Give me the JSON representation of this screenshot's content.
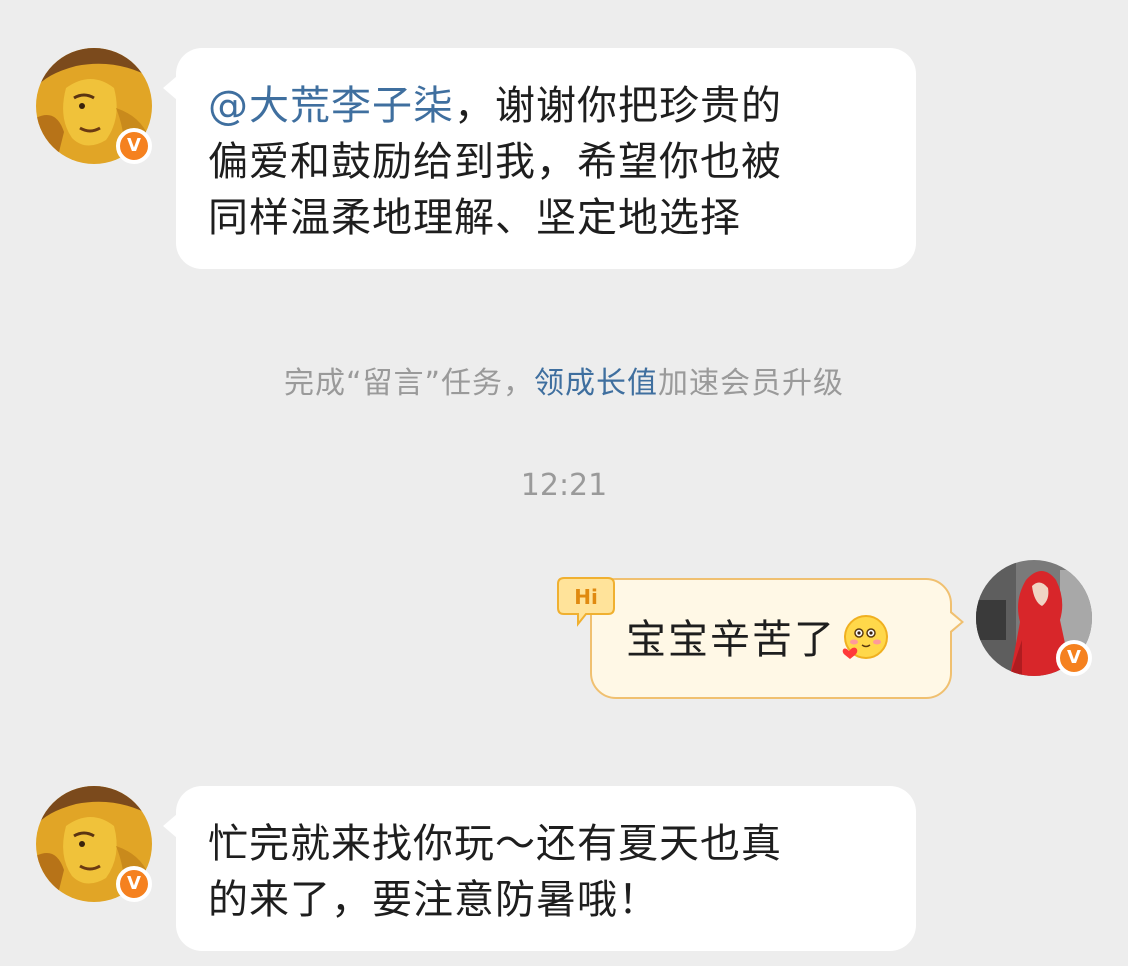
{
  "messages": [
    {
      "mention": "@大荒李子柒",
      "lines": [
        "，谢谢你把珍贵的",
        "偏爱和鼓励给到我，希望你也被",
        "同样温柔地理解、坚定地选择"
      ]
    },
    {
      "text": "宝宝辛苦了",
      "tag": "Hi"
    },
    {
      "lines": [
        "忙完就来找你玩～还有夏天也真",
        "的来了，要注意防暑哦！"
      ]
    }
  ],
  "notice": {
    "prefix": "完成“留言”任务，",
    "link": "领成长值",
    "suffix": "加速会员升级"
  },
  "timestamp": "12:21",
  "badge": "V",
  "colors": {
    "background": "#ededed",
    "link": "#3f6f9f",
    "badge": "#f5811f",
    "outgoing_bubble": "#fff8e6",
    "outgoing_border": "#f0c070"
  },
  "icons": {
    "emoji": "blush-heart-emoji",
    "tag": "hi-bubble-icon"
  }
}
